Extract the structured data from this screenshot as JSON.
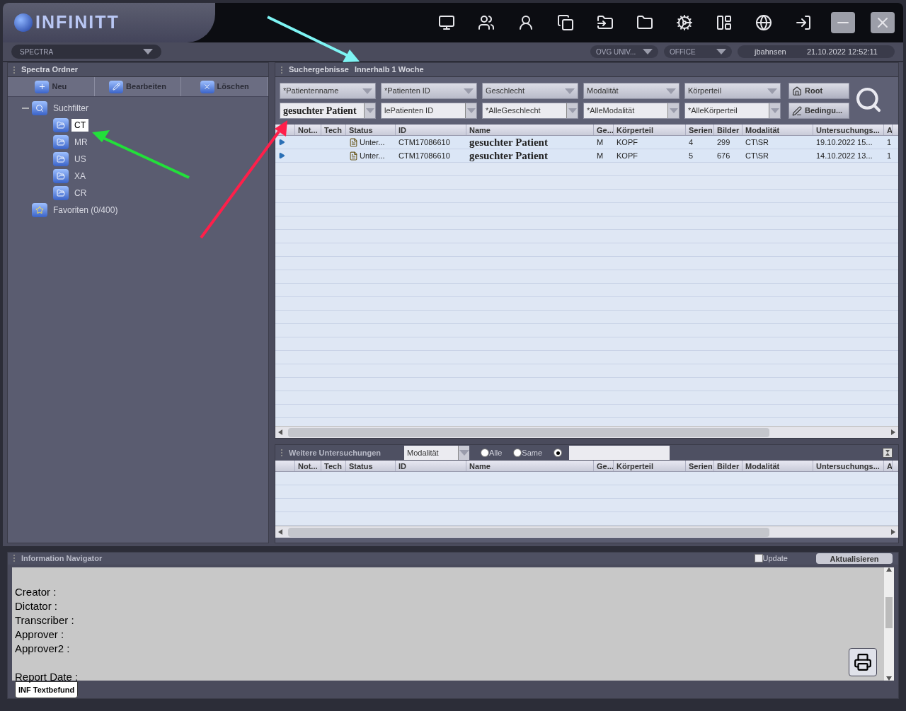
{
  "header": {
    "logo": "INFINITT",
    "database": "SPECTRA",
    "server": "OVG UNIV...",
    "location": "OFFICE",
    "user": "jbahnsen",
    "datetime": "21.10.2022 12:52:11"
  },
  "folders": {
    "title": "Spectra Ordner",
    "buttons": [
      {
        "label": "Neu",
        "kind": "new"
      },
      {
        "label": "Bearbeiten",
        "kind": "edit"
      },
      {
        "label": "Löschen",
        "kind": "delete"
      }
    ],
    "tree": [
      {
        "label": "Suchfilter",
        "kind": "filter",
        "expanded": true,
        "selected": false,
        "children": [
          {
            "label": "CT",
            "selected": true
          },
          {
            "label": "MR",
            "selected": false
          },
          {
            "label": "US",
            "selected": false
          },
          {
            "label": "XA",
            "selected": false
          },
          {
            "label": "CR",
            "selected": false
          }
        ]
      },
      {
        "label": "Favoriten (0/400)",
        "kind": "favorite",
        "selected": false
      }
    ]
  },
  "results": {
    "title": "Suchergebnisse",
    "subtitle": "Innerhalb 1 Woche",
    "filters": [
      {
        "label": "*Patientenname",
        "value": "gesuchter Patient",
        "kind": "overlay"
      },
      {
        "label": "*Patienten ID",
        "value": "lePatienten ID",
        "kind": "combo"
      },
      {
        "label": "Geschlecht",
        "value": "*AlleGeschlecht",
        "kind": "combo"
      },
      {
        "label": "Modalität",
        "value": "*AlleModalität",
        "kind": "combo"
      },
      {
        "label": "Körperteil",
        "value": "*AlleKörperteil",
        "kind": "combo"
      }
    ],
    "buttons": [
      {
        "label": "Root",
        "kind": "root"
      },
      {
        "label": "Bedingu...",
        "kind": "condition"
      }
    ],
    "columns": [
      "Not...",
      "Tech",
      "Status",
      "ID",
      "Name",
      "Ge...",
      "Körperteil",
      "Serien",
      "Bilder",
      "Modalität",
      "Untersuchungs...",
      "A"
    ],
    "rows": [
      {
        "cells": [
          "",
          "",
          "Unter...",
          "CTM17086610",
          "gesuchter Patient",
          "M",
          "KOPF",
          "4",
          "299",
          "CT\\SR",
          "19.10.2022 15...",
          "1"
        ]
      },
      {
        "cells": [
          "",
          "",
          "Unter...",
          "CTM17086610",
          "gesuchter Patient",
          "M",
          "KOPF",
          "5",
          "676",
          "CT\\SR",
          "14.10.2022 13...",
          "1"
        ]
      }
    ]
  },
  "further": {
    "title": "Weitere Untersuchungen",
    "select": "Modalität",
    "radios": [
      {
        "label": "Alle",
        "selected": false
      },
      {
        "label": "Same",
        "selected": false
      },
      {
        "selected": true
      }
    ],
    "columns": [
      "Not...",
      "Tech",
      "Status",
      "ID",
      "Name",
      "Ge...",
      "Körperteil",
      "Serien",
      "Bilder",
      "Modalität",
      "Untersuchungs...",
      "A"
    ]
  },
  "navigator": {
    "title": "Information Navigator",
    "update": {
      "label": "Update",
      "checked": false
    },
    "refresh": "Aktualisieren",
    "lines": [
      {
        "text": "Creator :"
      },
      {
        "text": "Dictator :"
      },
      {
        "text": "Transcriber :"
      },
      {
        "text": "Approver :"
      },
      {
        "text": "Approver2 :"
      },
      {
        "text": "Report Date :",
        "kind": "spaced"
      }
    ],
    "tab": "INF Textbefund"
  }
}
